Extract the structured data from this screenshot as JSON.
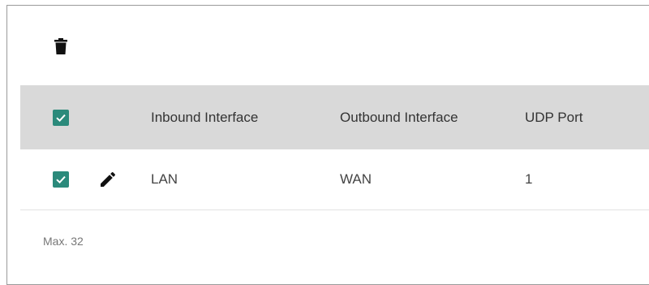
{
  "toolbar": {
    "delete_icon": "trash-icon"
  },
  "table": {
    "columns": [
      {
        "label": ""
      },
      {
        "label": ""
      },
      {
        "label": "Inbound Interface"
      },
      {
        "label": "Outbound Interface"
      },
      {
        "label": "UDP Port"
      }
    ],
    "select_all_checked": true,
    "rows": [
      {
        "checked": true,
        "inbound": "LAN",
        "outbound": "WAN",
        "udp_port": "1"
      }
    ]
  },
  "footer": {
    "max_label": "Max. 32"
  },
  "colors": {
    "checkbox_accent": "#2b8a7b",
    "header_bg": "#d9d9d9"
  }
}
